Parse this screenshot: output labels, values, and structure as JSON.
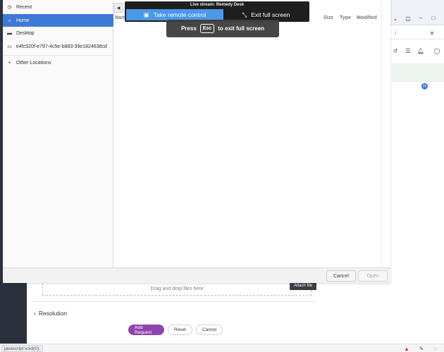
{
  "sidebar": {
    "items": [
      {
        "label": "Recent",
        "icon": "clock-icon",
        "selected": false
      },
      {
        "label": "Home",
        "icon": "home-icon",
        "selected": true
      },
      {
        "label": "Desktop",
        "icon": "folder-icon",
        "selected": false
      },
      {
        "label": "e4fc920f-e797-4c5e-b883-39e1824638cd",
        "icon": "drive-icon",
        "selected": false
      },
      {
        "label": "Other Locations",
        "icon": "plus-icon",
        "selected": false
      }
    ]
  },
  "file_list": {
    "columns": {
      "name": "Nam",
      "size": "Size",
      "type": "Type",
      "modified": "Modified"
    }
  },
  "dialog_footer": {
    "cancel_label": "Cancel",
    "open_label": "Open"
  },
  "live_stream": {
    "title": "Live stream: Remedy Desk",
    "take_control_label": "Take remote control",
    "exit_fullscreen_label": "Exit full screen"
  },
  "esc_banner": {
    "press": "Press",
    "key": "Esc",
    "suffix": "to exit full screen"
  },
  "form": {
    "drop_text": "Drag and drop files here",
    "attach_label": "Attach file",
    "resolution_label": "Resolution",
    "add_request_label": "Add Request",
    "reset_label": "Reset",
    "cancel_label": "Cancel"
  },
  "browser": {
    "notification_count": "25"
  },
  "statusbar": {
    "url": "javascript:void(0);"
  },
  "colors": {
    "accent_blue": "#3d7ad6",
    "take_control_blue": "#4b97e8",
    "primary_purple": "#8e44ad"
  }
}
